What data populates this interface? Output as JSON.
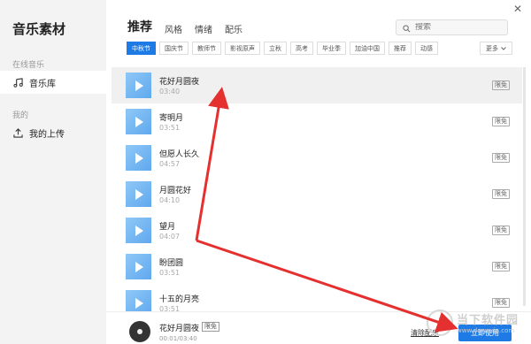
{
  "sidebar": {
    "title": "音乐素材",
    "online_section": "在线音乐",
    "library_label": "音乐库",
    "mine_section": "我的",
    "upload_label": "我的上传"
  },
  "tabs": [
    "推荐",
    "风格",
    "情绪",
    "配乐"
  ],
  "search": {
    "placeholder": "搜索"
  },
  "chips": [
    "中秋节",
    "国庆节",
    "教师节",
    "影视原声",
    "立秋",
    "高考",
    "毕业季",
    "加油中国",
    "推荐",
    "动感"
  ],
  "more_label": "更多",
  "free_badge": "限免",
  "songs": [
    {
      "name": "花好月圆夜",
      "duration": "03:40"
    },
    {
      "name": "寄明月",
      "duration": "03:51"
    },
    {
      "name": "但愿人长久",
      "duration": "04:57"
    },
    {
      "name": "月圆花好",
      "duration": "04:10"
    },
    {
      "name": "望月",
      "duration": "04:07"
    },
    {
      "name": "盼团圆",
      "duration": "03:51"
    },
    {
      "name": "十五的月亮",
      "duration": "03:51"
    }
  ],
  "player": {
    "name": "花好月圆夜",
    "free_badge": "限免",
    "time": "00:01/03:40",
    "clear_label": "清除配乐",
    "use_label": "立即使用"
  },
  "watermark": {
    "main": "当下软件园",
    "sub": "www.downxia.com"
  },
  "colors": {
    "accent": "#1e7be6",
    "arrow": "#e53030"
  }
}
